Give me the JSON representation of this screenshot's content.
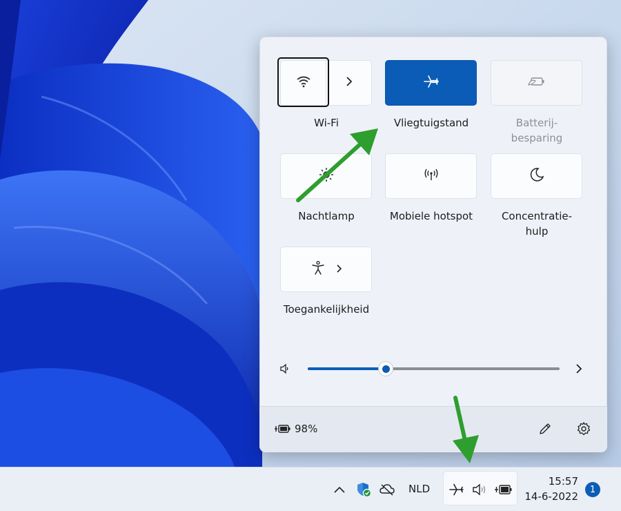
{
  "quick_settings": {
    "tiles": [
      {
        "label": "Wi-Fi",
        "icon": "wifi-icon",
        "active": false
      },
      {
        "label": "Vliegtuigstand",
        "icon": "airplane-icon",
        "active": true
      },
      {
        "label_line1": "Batterij-",
        "label_line2": "besparing",
        "icon": "battery-saver-icon",
        "active": false,
        "disabled": true
      },
      {
        "label": "Nachtlamp",
        "icon": "brightness-icon",
        "active": false
      },
      {
        "label": "Mobiele hotspot",
        "icon": "hotspot-icon",
        "active": false
      },
      {
        "label_line1": "Concentratie-",
        "label_line2": "hulp",
        "icon": "moon-icon",
        "active": false
      },
      {
        "label": "Toegankelijkheid",
        "icon": "accessibility-icon",
        "active": false
      }
    ],
    "volume": {
      "level": 0.31
    },
    "battery_text": "98%"
  },
  "taskbar": {
    "language": "NLD",
    "time": "15:57",
    "date": "14-6-2022",
    "notification_count": "1"
  },
  "colors": {
    "accent": "#0b5cb6",
    "annotation_arrow": "#2e9e2e"
  }
}
